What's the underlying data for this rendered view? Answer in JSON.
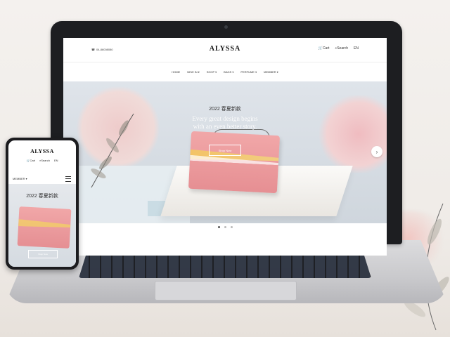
{
  "site": {
    "logo": "ALYSSA",
    "phone": "04-86008080",
    "cart": "Cart",
    "search": "Search",
    "lang": "EN",
    "nav": [
      "HOME",
      "NEW IN",
      "SHOP",
      "BAGS",
      "PERFUME",
      "MEMBER"
    ]
  },
  "hero": {
    "title": "2022 春夏新款",
    "subtitle_line1": "Every great design begins",
    "subtitle_line2": "with an even better story.",
    "button": "Shop Now",
    "next_icon": "chevron-right-icon",
    "dots": [
      true,
      false,
      false
    ]
  },
  "mobile": {
    "logo": "ALYSSA",
    "cart": "Cart",
    "search": "Search",
    "lang": "EN",
    "member": "MEMBER",
    "title": "2022 春夏新款",
    "button": "Shop Now"
  },
  "colors": {
    "bag_pink": "#e68f93",
    "accent_gold": "#f4c760",
    "hero_bg": "#dfe4ea"
  }
}
